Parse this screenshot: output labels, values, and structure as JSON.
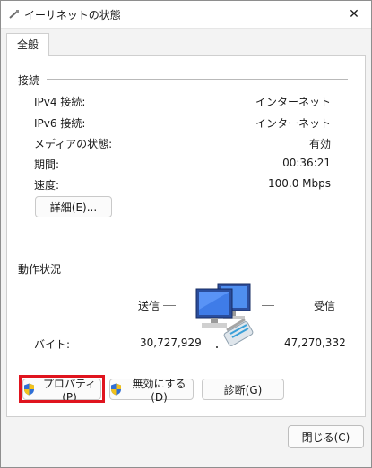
{
  "window": {
    "title": "イーサネットの状態",
    "close_glyph": "✕"
  },
  "tabs": [
    {
      "label": "全般"
    }
  ],
  "connection": {
    "group_label": "接続",
    "rows": [
      {
        "label": "IPv4 接続:",
        "value": "インターネット"
      },
      {
        "label": "IPv6 接続:",
        "value": "インターネット"
      },
      {
        "label": "メディアの状態:",
        "value": "有効"
      },
      {
        "label": "期間:",
        "value": "00:36:21"
      },
      {
        "label": "速度:",
        "value": "100.0 Mbps"
      }
    ],
    "details_button": "詳細(E)..."
  },
  "activity": {
    "group_label": "動作状況",
    "sent_label": "送信",
    "received_label": "受信",
    "bytes_label": "バイト:",
    "bytes_sent": "30,727,929",
    "bytes_received": "47,270,332",
    "icon": "network-computers-icon"
  },
  "buttons": {
    "properties": "プロパティ(P)",
    "disable": "無効にする(D)",
    "diagnose": "診断(G)",
    "close": "閉じる(C)"
  },
  "colors": {
    "highlight": "#e0141e",
    "shield_blue": "#2f6fd6",
    "shield_yellow": "#f2c21b"
  },
  "icons": {
    "title": "ethernet-cable-icon",
    "shield": "uac-shield-icon"
  }
}
